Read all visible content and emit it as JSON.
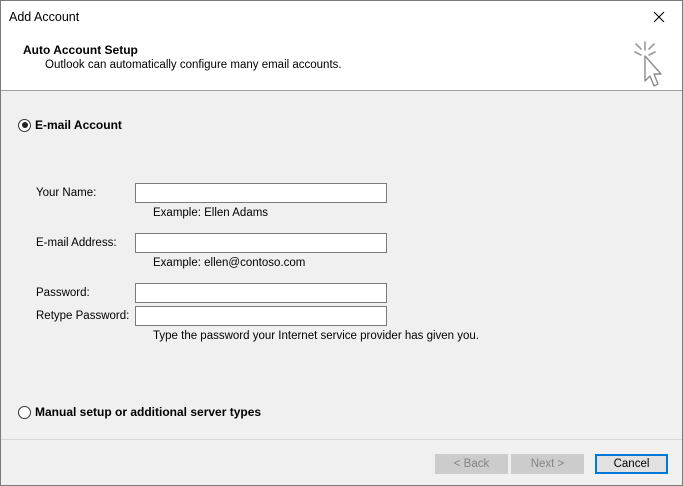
{
  "window": {
    "title": "Add Account",
    "close_glyph": "×"
  },
  "header": {
    "title": "Auto Account Setup",
    "subtitle": "Outlook can automatically configure many email accounts.",
    "icon": "cursor-click-sparkle-icon"
  },
  "options": {
    "email_account": {
      "label": "E-mail Account",
      "selected": true
    },
    "manual_setup": {
      "label": "Manual setup or additional server types",
      "selected": false
    }
  },
  "form": {
    "name": {
      "label": "Your Name:",
      "value": "",
      "example": "Example: Ellen Adams"
    },
    "email": {
      "label": "E-mail Address:",
      "value": "",
      "example": "Example: ellen@contoso.com"
    },
    "password": {
      "label": "Password:",
      "value": ""
    },
    "retype": {
      "label": "Retype Password:",
      "value": ""
    },
    "password_hint": "Type the password your Internet service provider has given you."
  },
  "buttons": {
    "back": {
      "label": "< Back",
      "enabled": false
    },
    "next": {
      "label": "Next >",
      "enabled": false
    },
    "cancel": {
      "label": "Cancel",
      "enabled": true
    }
  },
  "colors": {
    "accent": "#0078d7",
    "dialog_background": "#f0f0f0",
    "header_background": "#ffffff",
    "disabled_button": "#cccccc"
  }
}
